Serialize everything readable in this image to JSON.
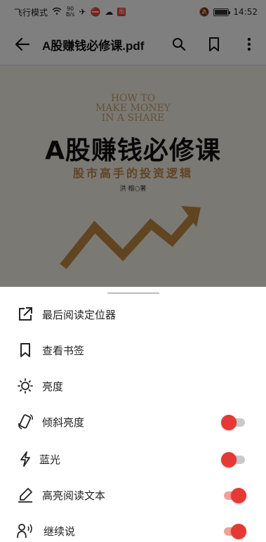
{
  "status_bar": {
    "left_text": "飞行模式",
    "net_speed_top": "90",
    "net_speed_bottom": "B/s",
    "time": "14:52",
    "battery_level": 0.95
  },
  "toolbar": {
    "title": "A股赚钱必修课.pdf"
  },
  "cover": {
    "english_title": "HOW TO\nMAKE MONEY\nIN A SHARE",
    "chinese_title": "A股赚钱必修课",
    "subtitle": "股市高手的投资逻辑",
    "author": "洪 榕○著"
  },
  "menu": {
    "items": [
      {
        "label": "最后阅读定位器",
        "icon": "open-external-icon"
      },
      {
        "label": "查看书签",
        "icon": "bookmark-icon"
      },
      {
        "label": "亮度",
        "icon": "brightness-icon"
      },
      {
        "label": "倾斜亮度",
        "icon": "tilt-phone-icon",
        "toggle": "off"
      },
      {
        "label": "蓝光",
        "icon": "lightning-icon",
        "toggle": "off"
      },
      {
        "label": "高亮阅读文本",
        "icon": "highlighter-icon",
        "toggle": "on"
      },
      {
        "label": "继续说",
        "icon": "speaking-person-icon",
        "toggle": "on"
      }
    ]
  },
  "colors": {
    "accent": "#e53935",
    "scrim": "rgba(0,0,0,0.5)"
  }
}
